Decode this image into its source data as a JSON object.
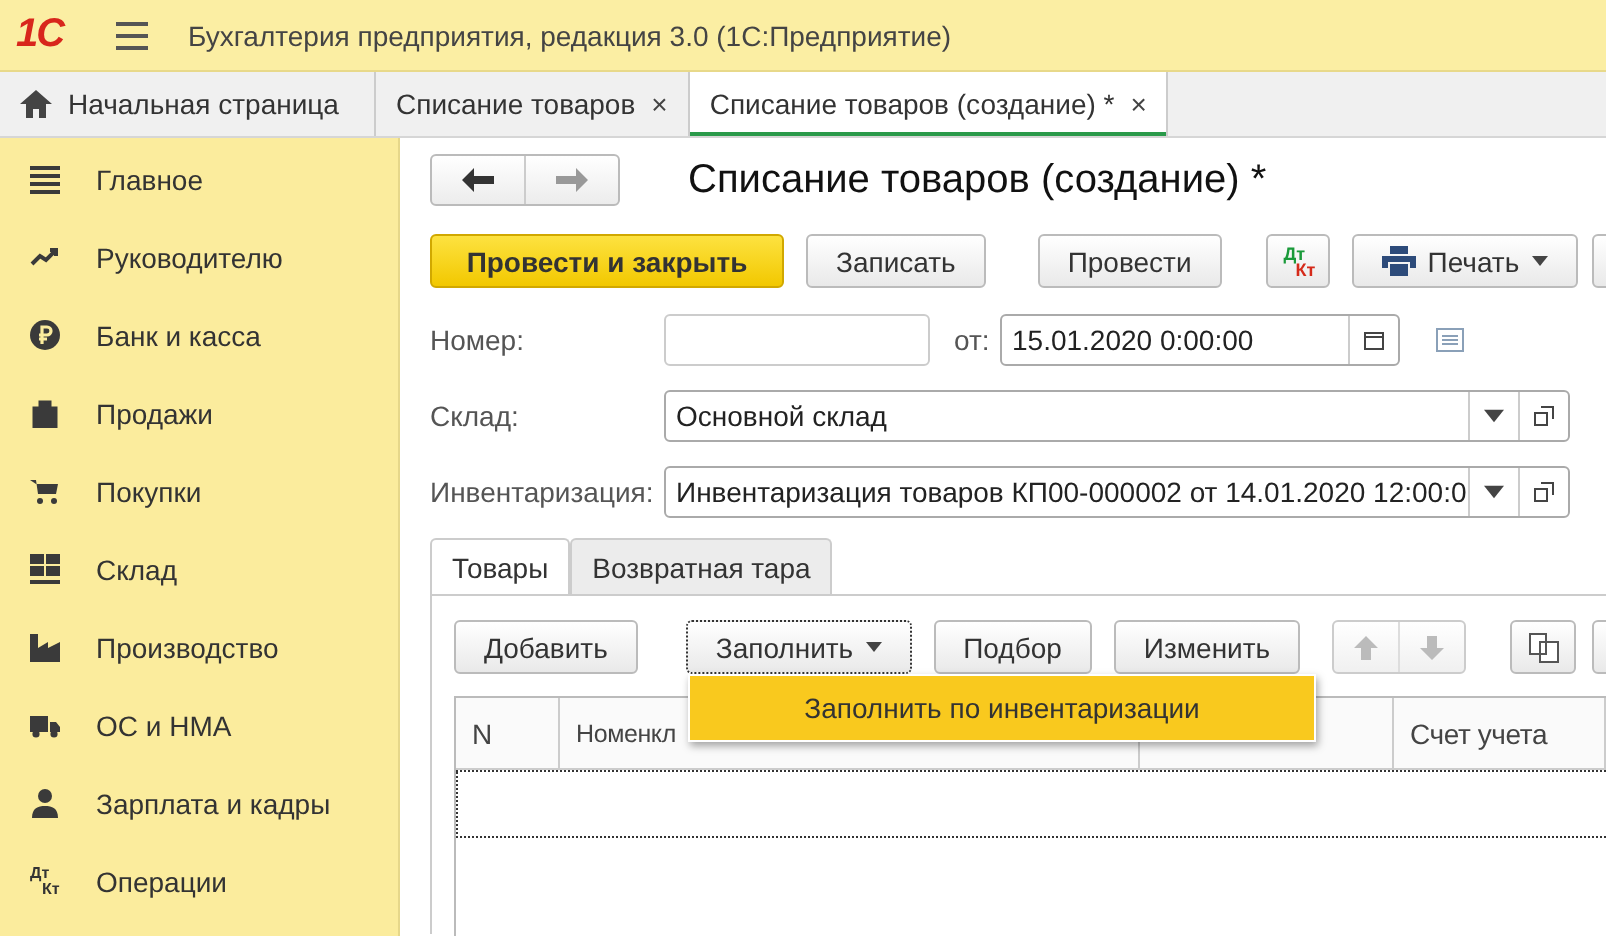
{
  "app_header": {
    "logo": "1С",
    "title": "Бухгалтерия предприятия, редакция 3.0  (1С:Предприятие)"
  },
  "open_tabs": [
    {
      "kind": "home",
      "label": "Начальная страница",
      "selected": false
    },
    {
      "kind": "doc",
      "label": "Списание товаров",
      "selected": false,
      "close": "×"
    },
    {
      "kind": "doc",
      "label": "Списание товаров (создание) *",
      "selected": true,
      "close": "×"
    }
  ],
  "sidebar": {
    "items": [
      {
        "kind": "menu",
        "label": "Главное"
      },
      {
        "kind": "chart",
        "label": "Руководителю"
      },
      {
        "kind": "ruble",
        "label": "Банк и касса"
      },
      {
        "kind": "bag",
        "label": "Продажи"
      },
      {
        "kind": "cart",
        "label": "Покупки"
      },
      {
        "kind": "grid",
        "label": "Склад"
      },
      {
        "kind": "factory",
        "label": "Производство"
      },
      {
        "kind": "truck",
        "label": "ОС и НМА"
      },
      {
        "kind": "person",
        "label": "Зарплата и кадры"
      },
      {
        "kind": "dtkt",
        "label": "Операции",
        "dt": "Дт",
        "kt": "Кт"
      }
    ]
  },
  "form": {
    "title": "Списание товаров (создание) *",
    "toolbar": [
      {
        "kind": "primary",
        "label": "Провести и закрыть"
      },
      {
        "kind": "plain",
        "label": "Записать"
      },
      {
        "kind": "plain",
        "label": "Провести"
      },
      {
        "kind": "dtkt",
        "dt": "Дт",
        "kt": "Кт"
      },
      {
        "kind": "print",
        "label": "Печать"
      },
      {
        "kind": "cut"
      }
    ],
    "number": {
      "label": "Номер:",
      "date_label": "от:",
      "date": "15.01.2020  0:00:00"
    },
    "warehouse": {
      "label": "Склад:",
      "value": "Основной склад"
    },
    "inventory": {
      "label": "Инвентаризация:",
      "value": "Инвентаризация товаров КП00-000002 от 14.01.2020 12:00:0"
    },
    "tabs": [
      {
        "label": "Товары",
        "selected": true
      },
      {
        "label": "Возвратная тара",
        "selected": false
      }
    ],
    "table_toolbar": [
      {
        "kind": "plain",
        "label": "Добавить"
      },
      {
        "kind": "menu",
        "label": "Заполнить",
        "focused": true
      },
      {
        "kind": "plain",
        "label": "Подбор"
      },
      {
        "kind": "plain",
        "label": "Изменить"
      },
      {
        "kind": "arrows"
      },
      {
        "kind": "copy"
      },
      {
        "kind": "cut"
      }
    ],
    "fill_menu": {
      "items": [
        {
          "label": "Заполнить по инвентаризации",
          "selected": true
        }
      ]
    },
    "table": {
      "columns": [
        {
          "kind": "text",
          "label": "N"
        },
        {
          "kind": "text",
          "label": "Номенкл"
        },
        {
          "kind": "blank"
        },
        {
          "kind": "text",
          "label": "Счет учета"
        }
      ]
    }
  }
}
